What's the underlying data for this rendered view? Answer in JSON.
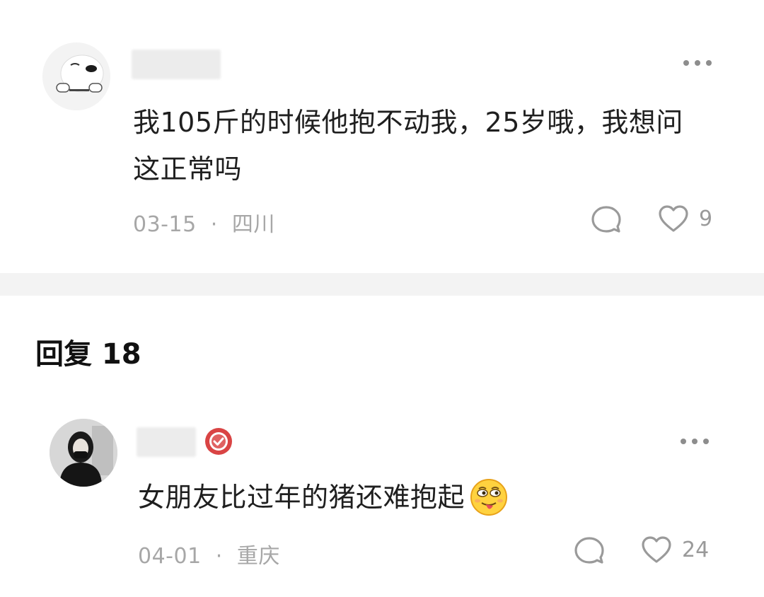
{
  "main_comment": {
    "avatar_icon": "cartoon-character-avatar",
    "text": "我105斤的时候他抱不动我，25岁哦，我想问这正常吗",
    "date": "03-15",
    "location": "四川",
    "likes": "9"
  },
  "replies_header": {
    "label": "回复 18"
  },
  "reply": {
    "avatar_icon": "person-photo-avatar",
    "badge_icon": "verified-badge-icon",
    "text": "女朋友比过年的猪还难抱起",
    "emoji": "tongue-out-emoji",
    "date": "04-01",
    "location": "重庆",
    "likes": "24"
  },
  "separator_dot": "·",
  "colors": {
    "text": "#1f1f1f",
    "meta": "#a7a7a7",
    "divider": "#f3f3f3",
    "badge": "#d94444"
  }
}
